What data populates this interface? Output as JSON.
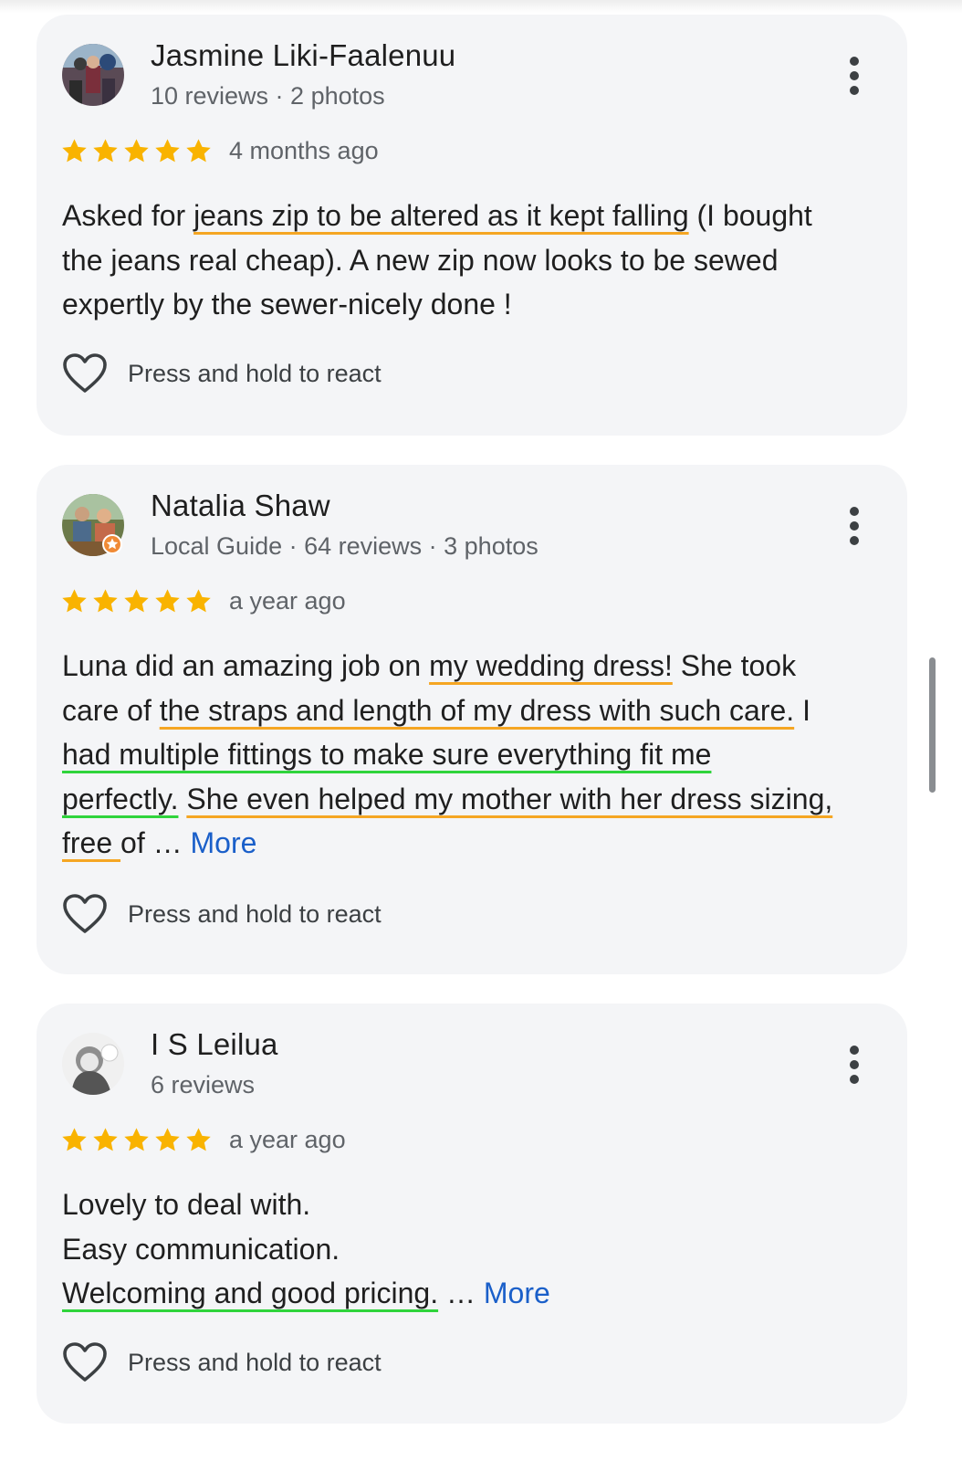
{
  "colors": {
    "card_bg": "#f4f5f7",
    "star": "#f9b300",
    "link": "#1a5fc9",
    "underline_orange": "#f5a623",
    "underline_green": "#2fd43c",
    "secondary_text": "#5f6368"
  },
  "icons": {
    "star": "star-icon",
    "react": "heart-outline-icon",
    "menu": "more-vert-icon",
    "guide_badge": "local-guide-star-badge-icon"
  },
  "reviews": [
    {
      "name": "Jasmine Liki-Faalenuu",
      "meta": "10 reviews · 2 photos",
      "rating": 5,
      "date": "4 months ago",
      "text_lines": [
        {
          "pre": "Asked for ",
          "orange": "jeans zip to be altered as it kept falling",
          "post": " (I bought"
        },
        {
          "pre": "the jeans real cheap). A new zip now looks to be sewed"
        },
        {
          "pre": "expertly by the sewer-nicely done !"
        }
      ],
      "react_label": "Press and hold to react"
    },
    {
      "name": "Natalia Shaw",
      "meta": "Local Guide · 64 reviews · 3 photos",
      "rating": 5,
      "date": "a year ago",
      "text_lines": [
        {
          "pre": "Luna did an amazing job on ",
          "orange": "my wedding dress!",
          "post": " She took"
        },
        {
          "pre": "care of ",
          "orange": "the straps and length of my dress with such care.",
          "post": " I"
        },
        {
          "green": "had multiple fittings to make sure everything fit me"
        },
        {
          "green": "perfectly.",
          "mid": " ",
          "orange": "She even helped my mother with her dress sizing,"
        },
        {
          "orange": "free ",
          "post": "of … ",
          "more": "More"
        }
      ],
      "react_label": "Press and hold to react"
    },
    {
      "name": "I S Leilua",
      "meta": "6 reviews",
      "rating": 5,
      "date": "a year ago",
      "text_lines": [
        {
          "pre": "Lovely to deal with."
        },
        {
          "pre": "Easy communication."
        },
        {
          "green": "Welcoming and good pricing.",
          "post": " … ",
          "more": "More"
        }
      ],
      "react_label": "Press and hold to react"
    }
  ]
}
